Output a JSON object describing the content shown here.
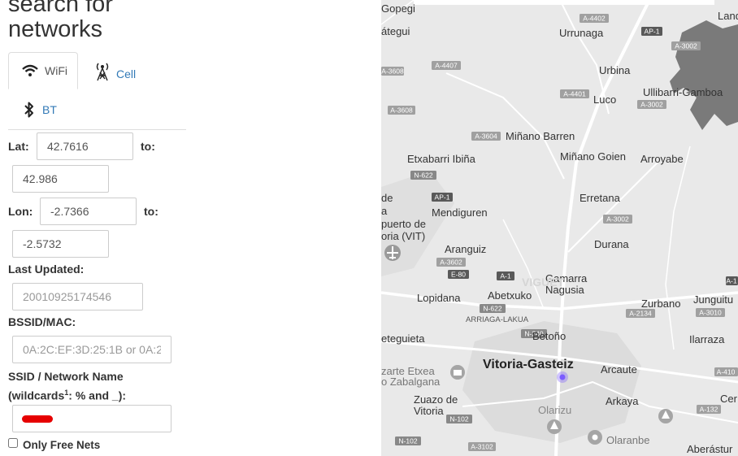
{
  "title": {
    "line1": "search for",
    "line2": "networks"
  },
  "tabs": [
    {
      "label": "WiFi",
      "icon": "wifi-icon",
      "active": true
    },
    {
      "label": "Cell",
      "icon": "cell-tower-icon",
      "active": false
    },
    {
      "label": "BT",
      "icon": "bluetooth-icon",
      "active": false
    }
  ],
  "form": {
    "lat_label": "Lat:",
    "lat_from": "42.7616",
    "lat_to_label": "to:",
    "lat_to": "42.986",
    "lon_label": "Lon:",
    "lon_from": "-2.7366",
    "lon_to_label": "to:",
    "lon_to": "-2.5732",
    "updated_label": "Last Updated:",
    "updated_placeholder": "20010925174546",
    "bssid_label": "BSSID/MAC:",
    "bssid_placeholder": "0A:2C:EF:3D:25:1B or 0A:2",
    "ssid_label_1": "SSID / Network Name",
    "ssid_label_2a": "(wildcards",
    "ssid_sup": "1",
    "ssid_label_2b": ": % and _):",
    "ssid_value": "",
    "free_label": "Only Free Nets"
  },
  "map": {
    "places": [
      "Gopegi",
      "átegui",
      "Urrunaga",
      "Landa",
      "Urbina",
      "Ullibarri-Gamboa",
      "Luco",
      "Miñano Barren",
      "Etxabarri Ibiña",
      "Miñano Goien",
      "Arroyabe",
      "de",
      "a",
      "puerto de",
      "oria (VIT)",
      "Erretana",
      "Mendiguren",
      "Durana",
      "Aranguiz",
      "Gamarra",
      "Nagusia",
      "Lopidana",
      "Abetxuko",
      "ARRIAGA-LAKUA",
      "Zurbano",
      "Junguitu",
      "eteguieta",
      "Betoño",
      "Ilarraza",
      "Vitoria-Gasteiz",
      "Arcaute",
      "zarte Etxea",
      "o Zabalgana",
      "Zuazo de",
      "Vitoria",
      "Olarizu",
      "Arkaya",
      "Cer",
      "Olaranbe",
      "Aberástur",
      "VIGUET"
    ],
    "roads": [
      "A-4402",
      "AP-1",
      "A-3002",
      "A-4407",
      "A-3608",
      "A-4401",
      "A-3002",
      "A-3608",
      "A-3604",
      "N-622",
      "AP-1",
      "A-3002",
      "A-3602",
      "A-1",
      "E-80",
      "N-622",
      "A-2134",
      "A-3010",
      "A-1",
      "N-240",
      "A-410",
      "N-102",
      "A-132",
      "N-102",
      "A-3102"
    ],
    "colors": {
      "land": "#e8e8e8",
      "water": "#7a7a7a",
      "road": "#ffffff",
      "label": "#333333",
      "marker": "#7b5cff"
    }
  }
}
